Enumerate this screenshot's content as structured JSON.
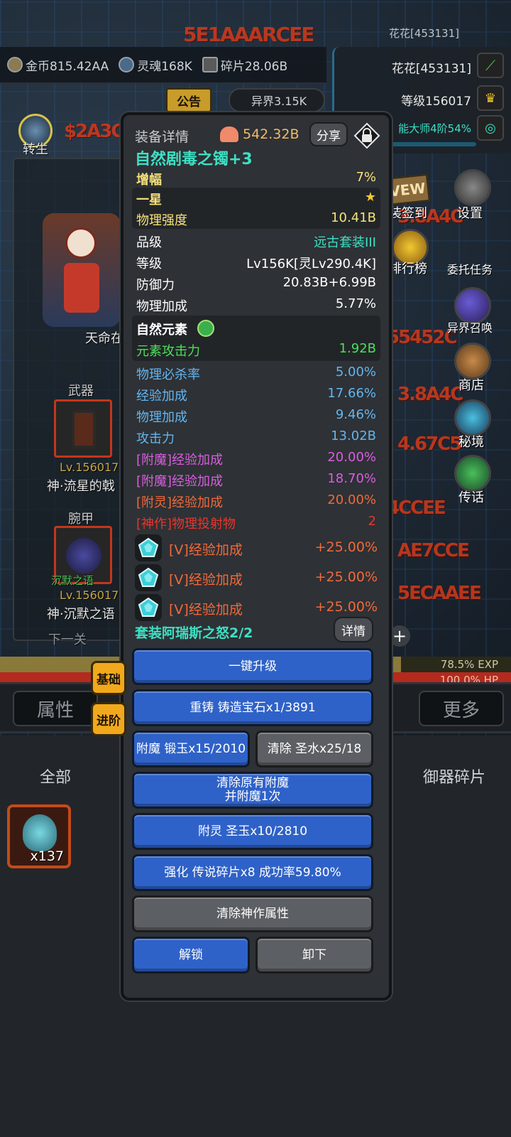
{
  "header": {
    "top_status": "花花[453131]",
    "currencies": [
      {
        "icon": "gold-coin-icon",
        "label": "金币815.42AA"
      },
      {
        "icon": "soul-icon",
        "label": "灵魂168K"
      },
      {
        "icon": "fragment-icon",
        "label": "碎片28.06B"
      }
    ],
    "notice_label": "公告",
    "otherworld_label": "异界3.15K",
    "player_name": "花花[453131]",
    "player_level": "等级156017",
    "skill_progress": "能大师4阶54%",
    "rebirth_label": "转生"
  },
  "side_menu": {
    "sign_in": "装签到",
    "settings": "设置",
    "ranking": "排行榜",
    "commission": "委托任务",
    "otherworld_summon": "异界召唤",
    "shop": "商店",
    "secret_realm": "秘境",
    "legend": "传话"
  },
  "hero": {
    "title": "天命在",
    "weapon_label": "武器",
    "weapon_level": "Lv.156017",
    "weapon_name": "神·流星的戟",
    "wrist_label": "腕甲",
    "wrist_tag": "沉默之语",
    "wrist_level": "Lv.156017",
    "wrist_name": "神·沉默之语",
    "next_label": "下一关"
  },
  "bars": {
    "exp": "78.5% EXP",
    "hp": "100.0% HP",
    "exp_level": 0.785,
    "hp_level": 1.0
  },
  "bottom_tabs": [
    "属性",
    "更多"
  ],
  "inventory": {
    "filter_all": "全部",
    "filter_fragments": "御器碎片",
    "item_count": "x137"
  },
  "modal": {
    "title": "装备详情",
    "power": "542.32B",
    "share": "分享",
    "item_name": "自然剧毒之镯+3",
    "amplify_label": "增幅",
    "amplify_value": "7%",
    "star_label": "一星",
    "stats": [
      {
        "label": "物理强度",
        "value": "10.41B",
        "color": "#f6e27a",
        "band": true
      },
      {
        "label": "品级",
        "value": "远古套装III",
        "color": "#ffffff",
        "valcolor": "#3de0c4"
      },
      {
        "label": "等级",
        "value": "Lv156K[灵Lv290.4K]",
        "color": "#ffffff"
      },
      {
        "label": "防御力",
        "value": "20.83B+6.99B",
        "color": "#ffffff"
      },
      {
        "label": "物理加成",
        "value": "5.77%",
        "color": "#ffffff"
      }
    ],
    "element_label": "自然元素",
    "element_attack_label": "元素攻击力",
    "element_attack_value": "1.92B",
    "bonus_stats": [
      {
        "label": "物理必杀率",
        "value": "5.00%",
        "color": "#62b6f2"
      },
      {
        "label": "经验加成",
        "value": "17.66%",
        "color": "#62b6f2"
      },
      {
        "label": "物理加成",
        "value": "9.46%",
        "color": "#62b6f2"
      },
      {
        "label": "攻击力",
        "value": "13.02B",
        "color": "#62b6f2"
      },
      {
        "label": "[附魔]经验加成",
        "value": "20.00%",
        "color": "#d85ee0"
      },
      {
        "label": "[附魔]经验加成",
        "value": "18.70%",
        "color": "#d85ee0"
      },
      {
        "label": "[附灵]经验加成",
        "value": "20.00%",
        "color": "#f2693a"
      },
      {
        "label": "[神作]物理投射物",
        "value": "2",
        "color": "#e8352e"
      }
    ],
    "gems": [
      {
        "label": "[V]经验加成",
        "value": "+25.00%"
      },
      {
        "label": "[V]经验加成",
        "value": "+25.00%"
      },
      {
        "label": "[V]经验加成",
        "value": "+25.00%"
      }
    ],
    "set_label": "套装阿瑞斯之怒2/2",
    "detail_button": "详情",
    "tab_basic": "基础",
    "tab_advanced": "进阶",
    "buttons": {
      "upgrade_all": "一键升级",
      "reforge": "重铸 铸造宝石x1/3891",
      "enchant": "附魔 锻玉x15/2010",
      "purify": "清除 圣水x25/18",
      "clear_enchant_1": "清除原有附魔",
      "clear_enchant_2": "并附魔1次",
      "spirit": "附灵 圣玉x10/2810",
      "strengthen": "强化 传说碎片x8 成功率59.80%",
      "clear_divine": "清除神作属性",
      "unlock": "解锁",
      "unequip": "卸下"
    }
  }
}
